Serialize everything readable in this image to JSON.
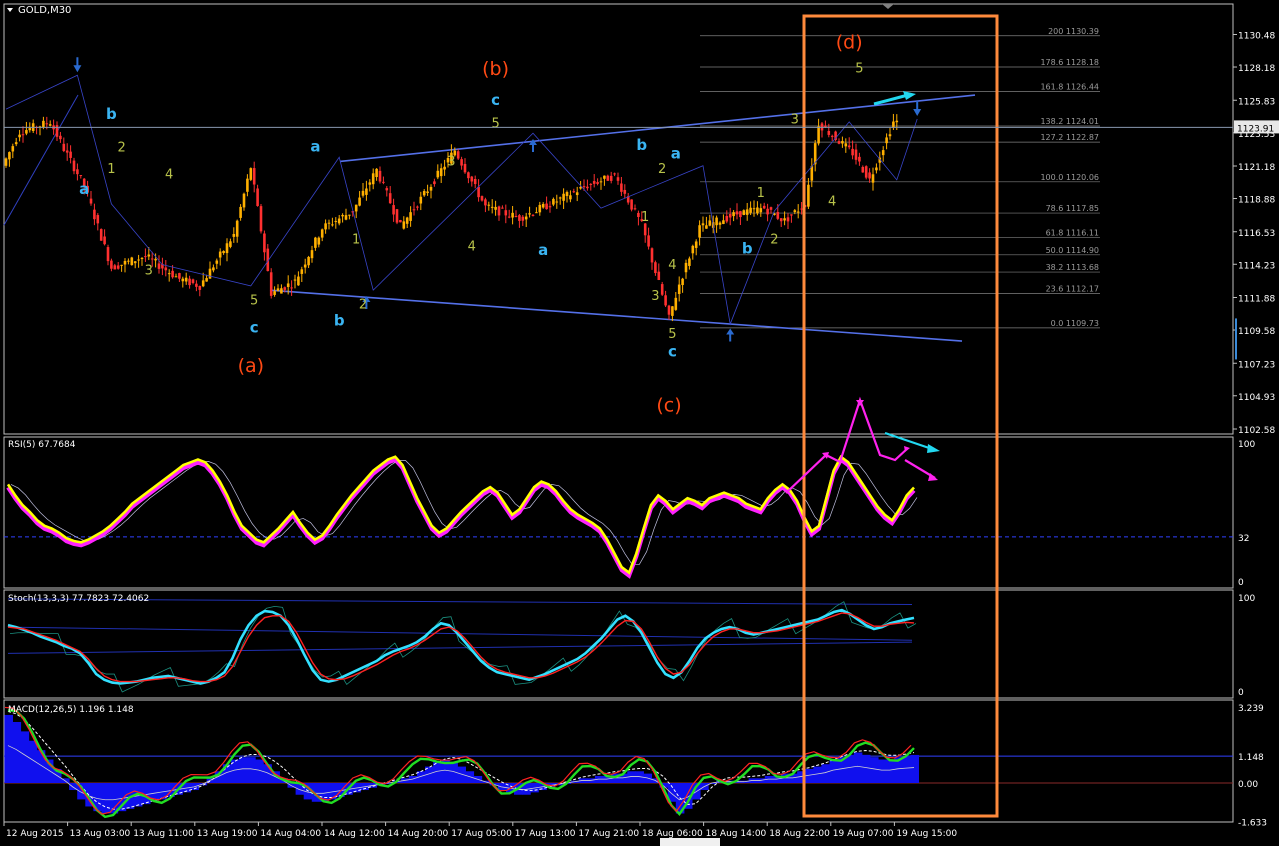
{
  "window": {
    "symbol_title": "GOLD,M30"
  },
  "colors": {
    "bg": "#000000",
    "frame": "#c0c0c0",
    "bull": "#ffb000",
    "bear": "#ff3030",
    "wave_blue": "#3ab4f2",
    "wave_green": "#b8c24a",
    "wave_orange": "#ff4a14",
    "channel": "#5470e8",
    "highlight_box": "#ff8a3c",
    "arrow_cyan": "#22d8f0",
    "arrow_magenta": "#ff22ee",
    "rsi_main": "#ffff00",
    "rsi_glow": "#ff22ff",
    "stoch_main": "#33e0ff",
    "stoch_signal": "#ff2222",
    "macd_hist": "#1010ee",
    "macd_main": "#22dd22",
    "macd_signal": "#ff2222"
  },
  "chart_data": [
    {
      "type": "candlestick",
      "title": "GOLD,M30",
      "ylim": [
        1102.58,
        1131.5
      ],
      "price_scale": [
        "1130.48",
        "1128.18",
        "1125.83",
        "1123.53",
        "1121.18",
        "1118.88",
        "1116.53",
        "1114.23",
        "1111.88",
        "1109.58",
        "1107.23",
        "1104.93",
        "1102.58"
      ],
      "current_price": "1123.91",
      "time_labels": [
        "12 Aug 2015",
        "13 Aug 03:00",
        "13 Aug 11:00",
        "13 Aug 19:00",
        "14 Aug 04:00",
        "14 Aug 12:00",
        "14 Aug 20:00",
        "17 Aug 05:00",
        "17 Aug 13:00",
        "17 Aug 21:00",
        "18 Aug 06:00",
        "18 Aug 14:00",
        "18 Aug 22:00",
        "19 Aug 07:00",
        "19 Aug 15:00"
      ],
      "pivots": [
        {
          "bar": 0,
          "price": 1121.2
        },
        {
          "bar": 5,
          "price": 1123.6
        },
        {
          "bar": 14,
          "price": 1124.3
        },
        {
          "bar": 18,
          "price": 1122.4
        },
        {
          "bar": 24,
          "price": 1119.8
        },
        {
          "bar": 32,
          "price": 1114.0
        },
        {
          "bar": 42,
          "price": 1114.8
        },
        {
          "bar": 52,
          "price": 1113.2
        },
        {
          "bar": 58,
          "price": 1112.7
        },
        {
          "bar": 68,
          "price": 1116.3
        },
        {
          "bar": 73,
          "price": 1121.1
        },
        {
          "bar": 79,
          "price": 1112.2
        },
        {
          "bar": 86,
          "price": 1113.0
        },
        {
          "bar": 94,
          "price": 1116.8
        },
        {
          "bar": 103,
          "price": 1118.0
        },
        {
          "bar": 110,
          "price": 1120.9
        },
        {
          "bar": 117,
          "price": 1116.9
        },
        {
          "bar": 125,
          "price": 1119.5
        },
        {
          "bar": 133,
          "price": 1122.3
        },
        {
          "bar": 142,
          "price": 1118.3
        },
        {
          "bar": 152,
          "price": 1117.5
        },
        {
          "bar": 162,
          "price": 1118.6
        },
        {
          "bar": 172,
          "price": 1119.8
        },
        {
          "bar": 180,
          "price": 1120.5
        },
        {
          "bar": 188,
          "price": 1117.0
        },
        {
          "bar": 196,
          "price": 1110.4
        },
        {
          "bar": 199,
          "price": 1112.8
        },
        {
          "bar": 205,
          "price": 1116.8
        },
        {
          "bar": 216,
          "price": 1117.8
        },
        {
          "bar": 224,
          "price": 1118.2
        },
        {
          "bar": 230,
          "price": 1117.3
        },
        {
          "bar": 236,
          "price": 1118.5
        },
        {
          "bar": 240,
          "price": 1124.2
        },
        {
          "bar": 250,
          "price": 1122.1
        },
        {
          "bar": 255,
          "price": 1120.2
        },
        {
          "bar": 262,
          "price": 1124.3
        }
      ],
      "fibonacci_levels": [
        {
          "ratio": "200",
          "price": "1130.39"
        },
        {
          "ratio": "178.6",
          "price": "1128.18"
        },
        {
          "ratio": "161.8",
          "price": "1126.44"
        },
        {
          "ratio": "138.2",
          "price": "1124.01"
        },
        {
          "ratio": "127.2",
          "price": "1122.87"
        },
        {
          "ratio": "100.0",
          "price": "1120.06"
        },
        {
          "ratio": "78.6",
          "price": "1117.85"
        },
        {
          "ratio": "61.8",
          "price": "1116.11"
        },
        {
          "ratio": "50.0",
          "price": "1114.90"
        },
        {
          "ratio": "38.2",
          "price": "1113.68"
        },
        {
          "ratio": "23.6",
          "price": "1112.17"
        },
        {
          "ratio": "0.0",
          "price": "1109.73"
        }
      ],
      "wave_labels": [
        {
          "text": "(a)",
          "kind": "orange",
          "bar": 72,
          "price": 1106.6
        },
        {
          "text": "(b)",
          "kind": "orange",
          "bar": 144,
          "price": 1127.6
        },
        {
          "text": "(c)",
          "kind": "orange",
          "bar": 195,
          "price": 1103.8
        },
        {
          "text": "(d)",
          "kind": "orange",
          "bar": 248,
          "price": 1129.5
        },
        {
          "text": "a",
          "kind": "blue",
          "bar": 23,
          "price": 1119.2
        },
        {
          "text": "b",
          "kind": "blue",
          "bar": 31,
          "price": 1124.5
        },
        {
          "text": "c",
          "kind": "blue",
          "bar": 73,
          "price": 1109.4
        },
        {
          "text": "a",
          "kind": "blue",
          "bar": 91,
          "price": 1122.2
        },
        {
          "text": "b",
          "kind": "blue",
          "bar": 98,
          "price": 1109.9
        },
        {
          "text": "c",
          "kind": "blue",
          "bar": 144,
          "price": 1125.5
        },
        {
          "text": "a",
          "kind": "blue",
          "bar": 158,
          "price": 1114.9
        },
        {
          "text": "b",
          "kind": "blue",
          "bar": 187,
          "price": 1122.3
        },
        {
          "text": "a",
          "kind": "blue",
          "bar": 197,
          "price": 1121.7
        },
        {
          "text": "c",
          "kind": "blue",
          "bar": 196,
          "price": 1107.7
        },
        {
          "text": "b",
          "kind": "blue",
          "bar": 218,
          "price": 1115.0
        },
        {
          "text": "1",
          "kind": "green",
          "bar": 31,
          "price": 1120.7
        },
        {
          "text": "2",
          "kind": "green",
          "bar": 34,
          "price": 1122.2
        },
        {
          "text": "3",
          "kind": "green",
          "bar": 42,
          "price": 1113.5
        },
        {
          "text": "4",
          "kind": "green",
          "bar": 48,
          "price": 1120.3
        },
        {
          "text": "5",
          "kind": "green",
          "bar": 73,
          "price": 1111.4
        },
        {
          "text": "1",
          "kind": "green",
          "bar": 103,
          "price": 1115.7
        },
        {
          "text": "2",
          "kind": "green",
          "bar": 105,
          "price": 1111.1
        },
        {
          "text": "3",
          "kind": "green",
          "bar": 131,
          "price": 1121.2
        },
        {
          "text": "4",
          "kind": "green",
          "bar": 137,
          "price": 1115.2
        },
        {
          "text": "5",
          "kind": "green",
          "bar": 144,
          "price": 1123.9
        },
        {
          "text": "1",
          "kind": "green",
          "bar": 188,
          "price": 1117.3
        },
        {
          "text": "2",
          "kind": "green",
          "bar": 193,
          "price": 1120.7
        },
        {
          "text": "3",
          "kind": "green",
          "bar": 191,
          "price": 1111.7
        },
        {
          "text": "4",
          "kind": "green",
          "bar": 196,
          "price": 1113.9
        },
        {
          "text": "5",
          "kind": "green",
          "bar": 196,
          "price": 1109.0
        },
        {
          "text": "1",
          "kind": "green",
          "bar": 222,
          "price": 1119.0
        },
        {
          "text": "2",
          "kind": "green",
          "bar": 226,
          "price": 1115.7
        },
        {
          "text": "3",
          "kind": "green",
          "bar": 232,
          "price": 1124.2
        },
        {
          "text": "4",
          "kind": "green",
          "bar": 243,
          "price": 1118.4
        },
        {
          "text": "5",
          "kind": "green",
          "bar": 251,
          "price": 1127.8
        }
      ]
    },
    {
      "type": "line",
      "title": "RSI(5) 67.7684",
      "ylim": [
        0,
        100
      ],
      "levels": [
        "100",
        "32",
        "0"
      ],
      "series": [
        {
          "name": "RSI(5)",
          "values": [
            70,
            62,
            55,
            50,
            44,
            40,
            38,
            35,
            31,
            29,
            28,
            30,
            33,
            36,
            40,
            45,
            50,
            56,
            60,
            64,
            68,
            72,
            76,
            80,
            84,
            86,
            88,
            86,
            80,
            72,
            62,
            50,
            40,
            35,
            30,
            28,
            33,
            38,
            44,
            50,
            42,
            35,
            30,
            33,
            40,
            48,
            55,
            62,
            68,
            74,
            80,
            84,
            88,
            90,
            84,
            72,
            60,
            50,
            40,
            35,
            38,
            44,
            50,
            55,
            60,
            65,
            68,
            64,
            56,
            48,
            52,
            60,
            68,
            72,
            70,
            65,
            58,
            52,
            48,
            45,
            42,
            38,
            30,
            20,
            10,
            6,
            20,
            38,
            55,
            62,
            58,
            52,
            56,
            60,
            58,
            55,
            60,
            62,
            64,
            62,
            60,
            56,
            54,
            52,
            60,
            66,
            70,
            66,
            58,
            46,
            36,
            40,
            60,
            80,
            90,
            86,
            78,
            70,
            62,
            54,
            48,
            44,
            52,
            62,
            67.7684
          ]
        }
      ]
    },
    {
      "type": "line",
      "title": "Stoch(13,3,3) 77.7823 72.4062",
      "ylim": [
        0,
        100
      ],
      "levels": [
        "100",
        "0"
      ],
      "series": [
        {
          "name": "Main",
          "values": [
            70,
            68,
            65,
            62,
            58,
            55,
            52,
            48,
            45,
            40,
            30,
            18,
            12,
            9,
            8,
            9,
            10,
            12,
            14,
            15,
            16,
            14,
            12,
            10,
            8,
            10,
            14,
            20,
            35,
            55,
            70,
            80,
            85,
            84,
            80,
            70,
            55,
            38,
            22,
            12,
            10,
            12,
            16,
            20,
            24,
            28,
            32,
            38,
            42,
            45,
            48,
            52,
            58,
            66,
            72,
            70,
            62,
            52,
            42,
            32,
            25,
            20,
            18,
            16,
            14,
            12,
            15,
            18,
            22,
            26,
            30,
            34,
            40,
            48,
            56,
            66,
            76,
            80,
            74,
            62,
            46,
            30,
            18,
            14,
            20,
            32,
            46,
            56,
            62,
            66,
            68,
            66,
            62,
            60,
            62,
            64,
            66,
            68,
            70,
            72,
            74,
            76,
            80,
            84,
            86,
            82,
            76,
            70,
            66,
            68,
            72,
            74,
            76,
            77.7823
          ]
        },
        {
          "name": "Signal",
          "values": [
            68,
            67,
            66,
            63,
            60,
            57,
            54,
            50,
            46,
            42,
            34,
            24,
            16,
            12,
            10,
            10,
            10,
            11,
            12,
            13,
            14,
            14,
            13,
            11,
            10,
            10,
            12,
            16,
            26,
            42,
            58,
            70,
            78,
            80,
            80,
            74,
            62,
            46,
            30,
            18,
            13,
            12,
            13,
            16,
            20,
            24,
            28,
            33,
            38,
            42,
            45,
            49,
            54,
            60,
            66,
            68,
            64,
            56,
            46,
            36,
            28,
            23,
            20,
            18,
            16,
            14,
            14,
            16,
            19,
            23,
            27,
            31,
            36,
            43,
            51,
            60,
            69,
            75,
            74,
            66,
            52,
            36,
            24,
            18,
            20,
            28,
            40,
            50,
            58,
            63,
            66,
            66,
            64,
            62,
            62,
            63,
            64,
            66,
            68,
            70,
            72,
            74,
            77,
            80,
            83,
            82,
            78,
            73,
            69,
            69,
            71,
            72,
            73,
            72.4062
          ]
        }
      ]
    },
    {
      "type": "bar",
      "title": "MACD(12,26,5) 1.196 1.148",
      "ylim": [
        -1.633,
        3.239
      ],
      "levels": [
        "3.239",
        "1.148",
        "0.00",
        "-1.633"
      ],
      "series": [
        {
          "name": "MACD",
          "values": [
            2.9,
            2.6,
            2.2,
            1.8,
            1.4,
            1.0,
            0.6,
            0.2,
            -0.3,
            -0.7,
            -1.0,
            -1.2,
            -1.3,
            -1.3,
            -1.2,
            -1.1,
            -1.0,
            -0.9,
            -0.8,
            -0.7,
            -0.6,
            -0.5,
            -0.4,
            -0.3,
            -0.1,
            0.2,
            0.5,
            0.8,
            1.0,
            1.1,
            1.1,
            1.0,
            0.8,
            0.5,
            0.2,
            -0.2,
            -0.5,
            -0.7,
            -0.8,
            -0.8,
            -0.7,
            -0.6,
            -0.5,
            -0.4,
            -0.3,
            -0.2,
            -0.1,
            0.0,
            0.1,
            0.2,
            0.3,
            0.5,
            0.7,
            0.9,
            1.0,
            0.9,
            0.7,
            0.5,
            0.3,
            0.1,
            -0.1,
            -0.3,
            -0.4,
            -0.5,
            -0.5,
            -0.4,
            -0.3,
            -0.2,
            -0.1,
            0.0,
            0.1,
            0.2,
            0.2,
            0.3,
            0.3,
            0.4,
            0.4,
            0.5,
            0.5,
            0.4,
            0.2,
            -0.2,
            -0.8,
            -1.3,
            -1.1,
            -0.7,
            -0.3,
            0.0,
            0.1,
            0.1,
            0.1,
            0.1,
            0.2,
            0.2,
            0.3,
            0.3,
            0.4,
            0.4,
            0.5,
            0.6,
            0.7,
            0.8,
            1.0,
            1.1,
            1.2,
            1.3,
            1.2,
            1.1,
            1.0,
            1.0,
            1.1,
            1.15,
            1.196
          ]
        }
      ]
    }
  ]
}
